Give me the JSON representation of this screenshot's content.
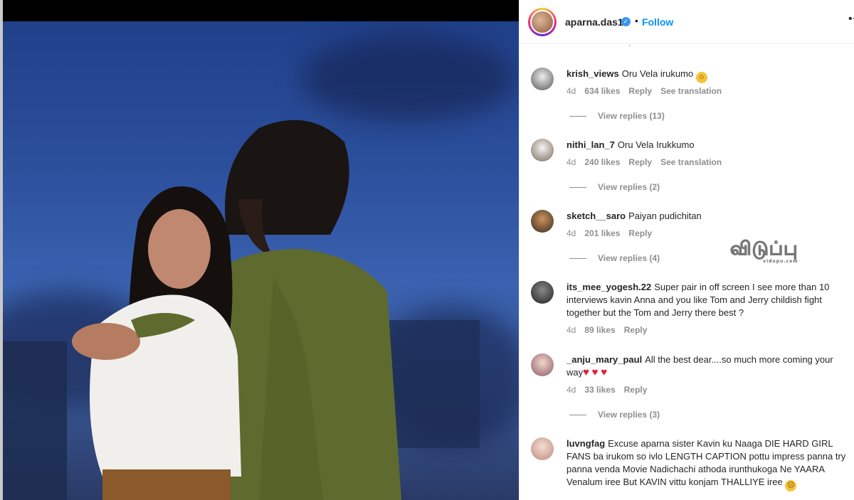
{
  "post": {
    "username": "aparna.das1",
    "verified": true,
    "follow_label": "Follow",
    "more_label": "••"
  },
  "watermark": {
    "text": "விடுப்பு",
    "sub": "vidupu.com"
  },
  "comments": [
    {
      "username": "krish_views",
      "text": "Oru Vela irukumo",
      "emoji": "grinning-face",
      "time": "4d",
      "likes": "634 likes",
      "reply": "Reply",
      "translate": "See translation",
      "replies": "View replies (13)"
    },
    {
      "username": "nithi_lan_7",
      "text": "Oru Vela Irukkumo",
      "time": "4d",
      "likes": "240 likes",
      "reply": "Reply",
      "translate": "See translation",
      "replies": "View replies (2)"
    },
    {
      "username": "sketch__saro",
      "text": "Paiyan pudichitan",
      "time": "4d",
      "likes": "201 likes",
      "reply": "Reply",
      "replies": "View replies (4)"
    },
    {
      "username": "its_mee_yogesh.22",
      "text": "Super pair in off screen I see more than 10 interviews kavin Anna and you like Tom and Jerry childish fight together but the Tom and Jerry there best ?",
      "time": "4d",
      "likes": "89 likes",
      "reply": "Reply"
    },
    {
      "username": "_anju_mary_paul",
      "text": "All the best dear....so much more coming your way",
      "emoji": "red-heart x3",
      "time": "4d",
      "likes": "33 likes",
      "reply": "Reply",
      "replies": "View replies (3)"
    },
    {
      "username": "luvngfag",
      "text": "Excuse aparna sister Kavin ku Naaga DIE HARD GIRL FANS ba irukom so ivlo LENGTH CAPTION pottu impress panna try panna venda Movie Nadichachi athoda irunthukoga Ne YAARA Venalum iree But KAVIN vittu konjam THALLIYE iree",
      "emoji": "unamused-face"
    }
  ],
  "icons": {
    "verified": "verified-badge-icon",
    "heart": "red-heart"
  }
}
